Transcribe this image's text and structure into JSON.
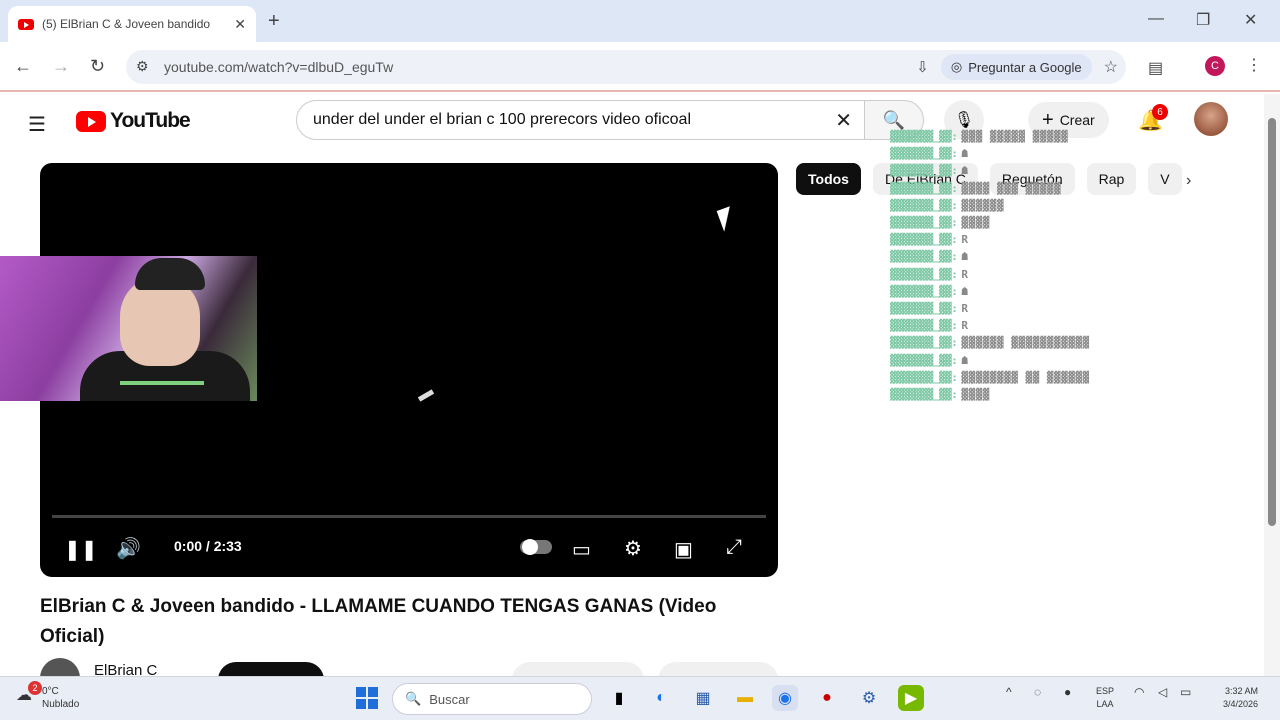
{
  "browser": {
    "tab_title": "(5) ElBrian C & Joveen bandido",
    "url": "youtube.com/watch?v=dlbuD_eguTw",
    "google_button": "Preguntar a Google",
    "profile_initial": "C"
  },
  "youtube": {
    "logo_text": "YouTube",
    "search_query": "under del under el brian c 100 prerecors  video oficoal",
    "create_label": "Crear",
    "notification_count": "6"
  },
  "player": {
    "time": "0:00 / 2:33"
  },
  "chips": [
    "Todos",
    "De ElBrian C",
    "Reguetón",
    "Rap",
    "V"
  ],
  "chat": [
    {
      "user": "▓▓▓▓▓▓▓_▓▓:",
      "msg": "▓▓▓ ▓▓▓▓▓ ▓▓▓▓▓"
    },
    {
      "user": "▓▓▓▓▓▓▓_▓▓:",
      "msg": "☗"
    },
    {
      "user": "▓▓▓▓▓▓▓_▓▓:",
      "msg": "☗"
    },
    {
      "user": "▓▓▓▓▓▓▓_▓▓:",
      "msg": "▓▓▓▓ ▓▓▓ ▓▓▓▓▓"
    },
    {
      "user": "▓▓▓▓▓▓▓_▓▓:",
      "msg": "▓▓▓▓▓▓"
    },
    {
      "user": "▓▓▓▓▓▓▓_▓▓:",
      "msg": "▓▓▓▓"
    },
    {
      "user": "▓▓▓▓▓▓▓_▓▓:",
      "msg": "R"
    },
    {
      "user": "▓▓▓▓▓▓▓_▓▓:",
      "msg": "☗"
    },
    {
      "user": "▓▓▓▓▓▓▓_▓▓:",
      "msg": "R"
    },
    {
      "user": "▓▓▓▓▓▓▓_▓▓:",
      "msg": "☗"
    },
    {
      "user": "▓▓▓▓▓▓▓_▓▓:",
      "msg": "R"
    },
    {
      "user": "▓▓▓▓▓▓▓_▓▓:",
      "msg": "R"
    },
    {
      "user": "▓▓▓▓▓▓▓_▓▓:",
      "msg": "▓▓▓▓▓▓ ▓▓▓▓▓▓▓▓▓▓▓"
    },
    {
      "user": "▓▓▓▓▓▓▓_▓▓:",
      "msg": "☗"
    },
    {
      "user": "▓▓▓▓▓▓▓_▓▓:",
      "msg": "▓▓▓▓▓▓▓▓ ▓▓ ▓▓▓▓▓▓"
    },
    {
      "user": "▓▓▓▓▓▓▓_▓▓:",
      "msg": "▓▓▓▓"
    }
  ],
  "video": {
    "title": "ElBrian C & Joveen bandido - LLAMAME CUANDO TENGAS GANAS (Video Oficial)",
    "channel": "ElBrian C"
  },
  "taskbar": {
    "weather_temp": "0°C",
    "weather_desc": "Nublado",
    "weather_badge": "2",
    "search_placeholder": "Buscar",
    "lang_line1": "ESP",
    "lang_line2": "LAA",
    "time": "3:32 AM",
    "date": "3/4/2026"
  }
}
